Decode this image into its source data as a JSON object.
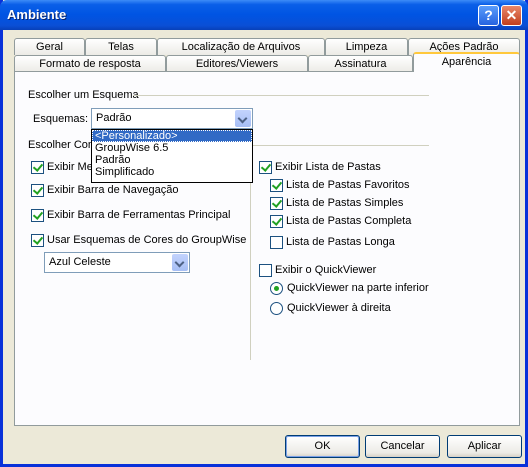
{
  "window": {
    "title": "Ambiente"
  },
  "title_buttons": {
    "help": "?",
    "close": "✕"
  },
  "tabs_row1": [
    "Geral",
    "Telas",
    "Localização de Arquivos",
    "Limpeza",
    "Ações Padrão"
  ],
  "tabs_row2": [
    "Formato de resposta",
    "Editores/Viewers",
    "Assinatura",
    "Aparência"
  ],
  "scheme": {
    "group_label": "Escolher um Esquema",
    "label": "Esquemas:",
    "value": "Padrão",
    "options": [
      "<Personalizado>",
      "GroupWise 6.5",
      "Padrão",
      "Simplificado"
    ]
  },
  "components": {
    "group_label": "Escolher Componentes",
    "left": [
      {
        "label": "Exibir Menu",
        "checked": true
      },
      {
        "label": "Exibir Barra de Navegação",
        "checked": true
      },
      {
        "label": "Exibir Barra de Ferramentas Principal",
        "checked": true
      },
      {
        "label": "Usar Esquemas de Cores do GroupWise",
        "checked": true
      }
    ],
    "color_scheme": "Azul Celeste",
    "folder_list": {
      "label": "Exibir Lista de Pastas",
      "checked": true
    },
    "folder_sub": [
      {
        "label": "Lista de Pastas Favoritos",
        "checked": true
      },
      {
        "label": "Lista de Pastas Simples",
        "checked": true
      },
      {
        "label": "Lista de Pastas Completa",
        "checked": true
      },
      {
        "label": "Lista de Pastas Longa",
        "checked": false
      }
    ],
    "quickviewer": {
      "label": "Exibir o QuickViewer",
      "checked": false
    },
    "qv_options": [
      {
        "label": "QuickViewer na parte inferior",
        "selected": true
      },
      {
        "label": "QuickViewer à direita",
        "selected": false
      }
    ]
  },
  "buttons": {
    "ok": "OK",
    "cancel": "Cancelar",
    "apply": "Aplicar"
  }
}
